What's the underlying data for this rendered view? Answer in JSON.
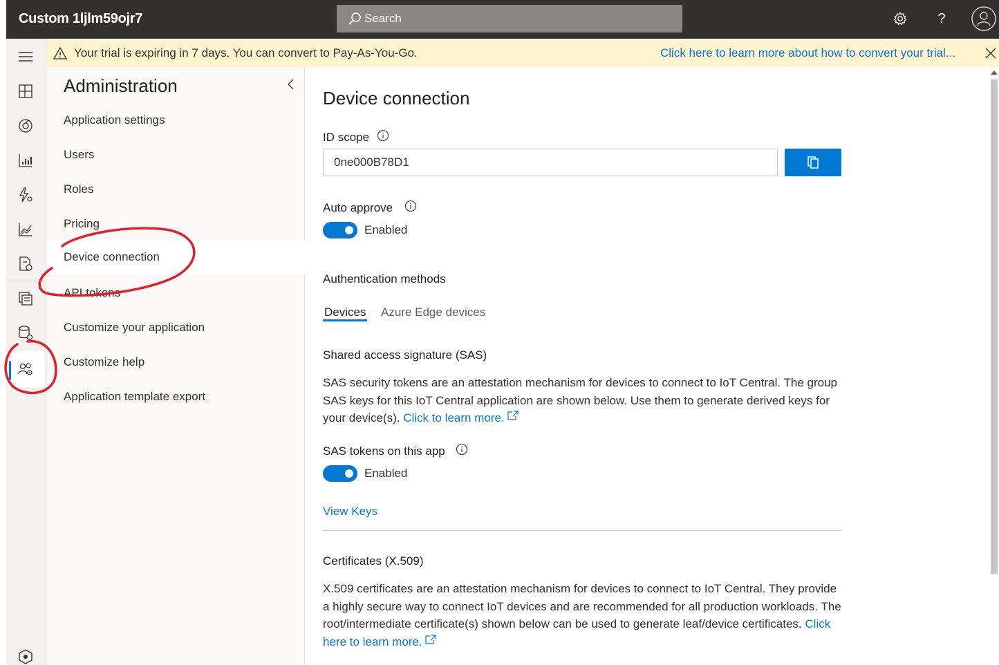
{
  "app": {
    "title": "Custom 1ljlm59ojr7"
  },
  "topbar": {
    "search_placeholder": "Search",
    "icons": [
      "search-icon",
      "settings-gear-icon",
      "help-icon",
      "user-avatar-icon"
    ],
    "help_glyph": "?"
  },
  "banner": {
    "message": "Your trial is expiring in 7 days. You can convert to Pay-As-You-Go.",
    "link": "Click here to learn more about how to convert your trial...",
    "background": "#fff4ce"
  },
  "rail": {
    "icons": [
      "hamburger-menu-icon",
      "dashboard-icon",
      "devices-icon",
      "device-groups-icon",
      "rules-icon",
      "analytics-icon",
      "jobs-icon",
      "device-templates-icon",
      "data-export-icon",
      "administration-icon",
      "iot-central-icon"
    ]
  },
  "admin": {
    "title": "Administration",
    "items": [
      {
        "label": "Application settings"
      },
      {
        "label": "Users"
      },
      {
        "label": "Roles"
      },
      {
        "label": "Pricing"
      },
      {
        "label": "Device connection",
        "active": true
      },
      {
        "label": "API tokens"
      },
      {
        "label": "Customize your application"
      },
      {
        "label": "Customize help"
      },
      {
        "label": "Application template export"
      }
    ]
  },
  "main": {
    "title": "Device connection",
    "id_scope": {
      "label": "ID scope",
      "value": "0ne000B78D1"
    },
    "auto_approve": {
      "label": "Auto approve",
      "state": "Enabled"
    },
    "auth_methods": {
      "title": "Authentication methods",
      "tabs": [
        {
          "label": "Devices",
          "active": true
        },
        {
          "label": "Azure Edge devices",
          "active": false
        }
      ]
    },
    "sas": {
      "title": "Shared access signature (SAS)",
      "description": "SAS security tokens are an attestation mechanism for devices to connect to IoT Central. The group SAS keys for this IoT Central application are shown below. Use them to generate derived keys for your device(s).",
      "learn_more": "Click to learn more.",
      "tokens_label": "SAS tokens on this app",
      "tokens_state": "Enabled",
      "view_keys": "View Keys"
    },
    "certificates": {
      "title": "Certificates (X.509)",
      "description": "X.509 certificates are an attestation mechanism for devices to connect to IoT Central. They provide a highly secure way to connect IoT devices and are recommended for all production workloads. The root/intermediate certificate(s) shown below can be used to generate leaf/device certificates.",
      "learn_more": "Click here to learn more."
    }
  },
  "colors": {
    "accent": "#0078d4",
    "topbar": "#323130",
    "annotation": "#e3202a"
  }
}
